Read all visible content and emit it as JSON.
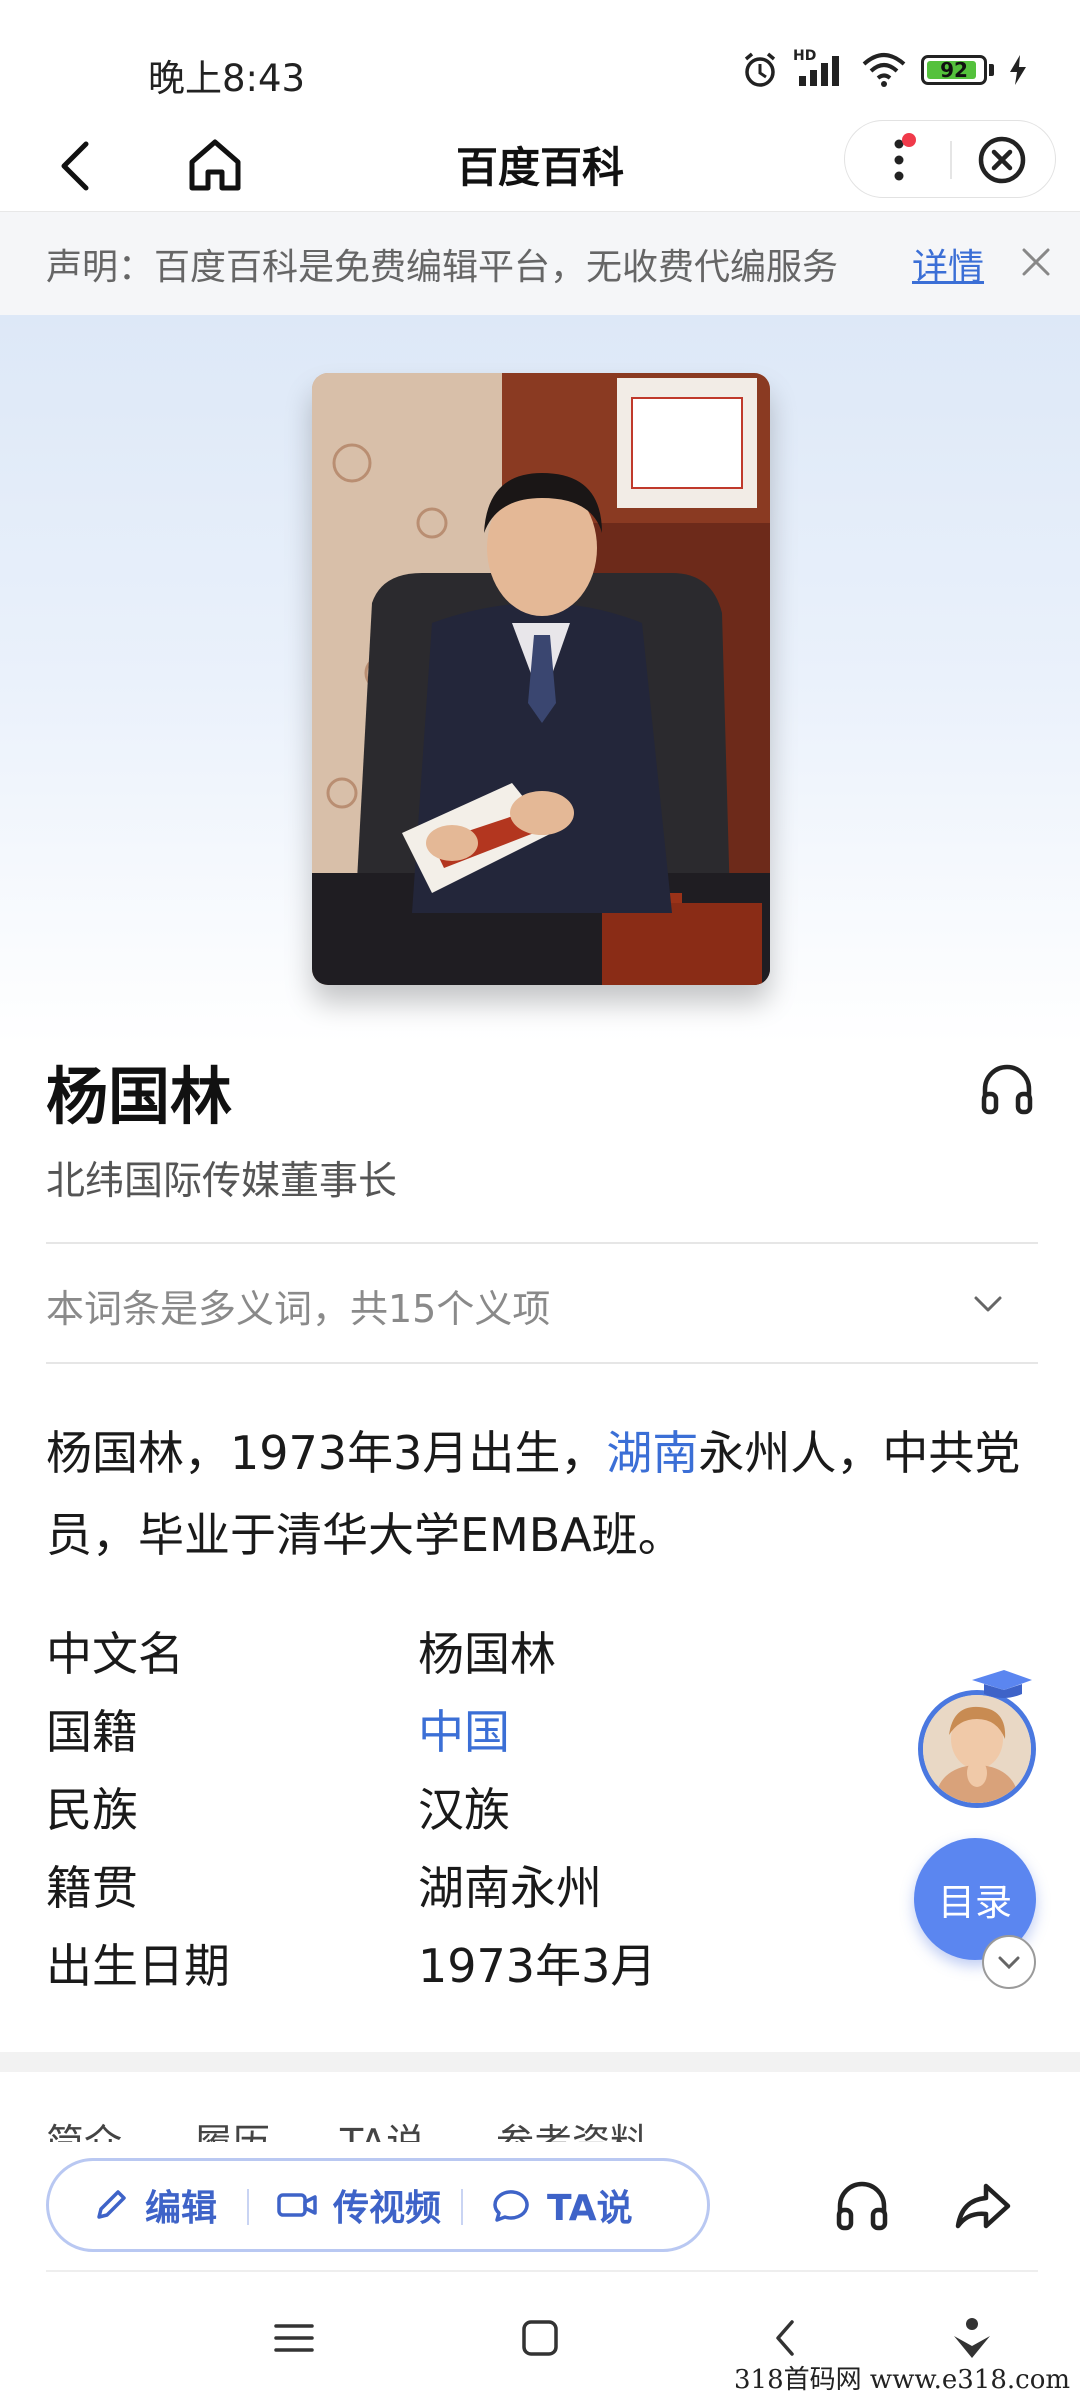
{
  "status": {
    "time": "晚上8:43",
    "battery": "92",
    "network": "HD"
  },
  "navbar": {
    "title": "百度百科"
  },
  "notice": {
    "text": "声明：百度百科是免费编辑平台，无收费代编服务",
    "link": "详情"
  },
  "entry": {
    "name": "杨国林",
    "subtitle": "北纬国际传媒董事长",
    "polysemy": "本词条是多义词，共15个义项",
    "summary_part1": "杨国林，1973年3月出生，",
    "summary_link": "湖南",
    "summary_part2": "永州人，中共党员，毕业于清华大学EMBA班。"
  },
  "infobox": [
    {
      "key": "中文名",
      "value": "杨国林"
    },
    {
      "key": "国籍",
      "value": "中国"
    },
    {
      "key": "民族",
      "value": "汉族"
    },
    {
      "key": "籍贯",
      "value": "湖南永州"
    },
    {
      "key": "出生日期",
      "value": "1973年3月"
    }
  ],
  "toc_button": "目录",
  "tabs": [
    "简介",
    "履历",
    "TA说",
    "参考资料"
  ],
  "toolbar": {
    "edit": "编辑",
    "video": "传视频",
    "ta_say": "TA说"
  },
  "watermark": "318首码网  www.e318.com",
  "icons": {
    "accent": "#3b6fd6",
    "toc_bg": "#5b86f0",
    "battery_fill": "#54c13c",
    "notification_dot": "#f03a4a"
  }
}
